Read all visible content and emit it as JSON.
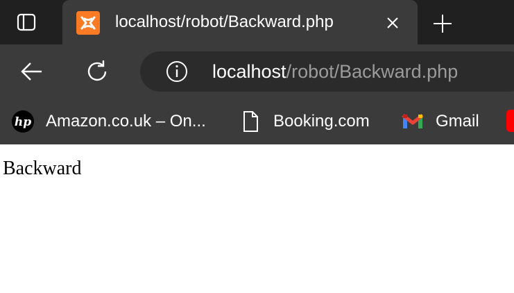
{
  "colors": {
    "tabstrip_bg": "#202020",
    "toolbar_bg": "#3b3b3b",
    "address_bg": "#2b2b2b",
    "favicon_bg": "#fb7a24",
    "url_path": "#9b9b9b",
    "gmail_red": "#ea4335"
  },
  "tab": {
    "favicon": "xampp-icon",
    "title": "localhost/robot/Backward.php",
    "close_icon": "close-icon"
  },
  "toolbar": {
    "back_icon": "back-arrow-icon",
    "reload_icon": "reload-icon",
    "site_info_icon": "info-icon",
    "url_host": "localhost",
    "url_path": "/robot/Backward.php"
  },
  "bookmarks": [
    {
      "icon": "hp-logo-icon",
      "label": "Amazon.co.uk – On..."
    },
    {
      "icon": "page-icon",
      "label": "Booking.com"
    },
    {
      "icon": "gmail-icon",
      "label": "Gmail"
    }
  ],
  "page": {
    "text": "Backward"
  }
}
